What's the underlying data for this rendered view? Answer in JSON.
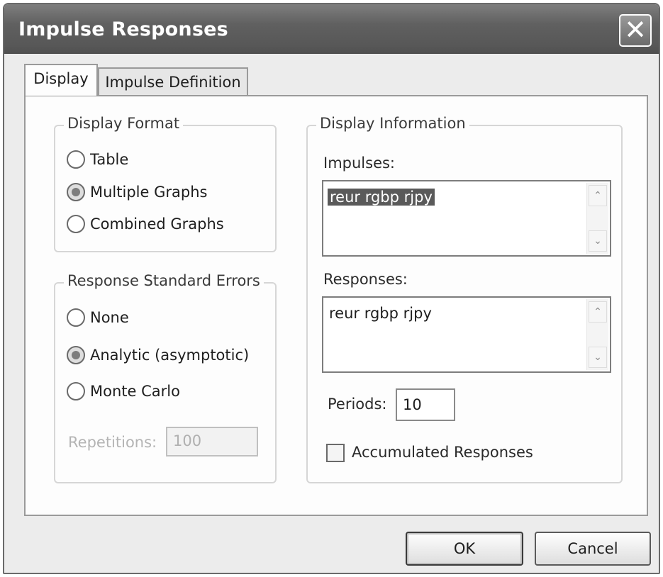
{
  "window": {
    "title": "Impulse Responses",
    "close_icon": "close-icon"
  },
  "tabs": [
    {
      "label": "Display",
      "active": true
    },
    {
      "label": "Impulse Definition",
      "active": false
    }
  ],
  "display_format": {
    "legend": "Display Format",
    "options": [
      {
        "label": "Table",
        "selected": false
      },
      {
        "label": "Multiple Graphs",
        "selected": true
      },
      {
        "label": "Combined Graphs",
        "selected": false
      }
    ]
  },
  "standard_errors": {
    "legend": "Response Standard Errors",
    "options": [
      {
        "label": "None",
        "selected": false
      },
      {
        "label": "Analytic (asymptotic)",
        "selected": true
      },
      {
        "label": "Monte Carlo",
        "selected": false
      }
    ],
    "repetitions_label": "Repetitions:",
    "repetitions_value": "100"
  },
  "display_information": {
    "legend": "Display Information",
    "impulses_label": "Impulses:",
    "impulses_value": "reur rgbp rjpy",
    "responses_label": "Responses:",
    "responses_value": "reur rgbp rjpy",
    "periods_label": "Periods:",
    "periods_value": "10",
    "accumulated_label": "Accumulated Responses",
    "accumulated_checked": false
  },
  "buttons": {
    "ok": "OK",
    "cancel": "Cancel"
  }
}
